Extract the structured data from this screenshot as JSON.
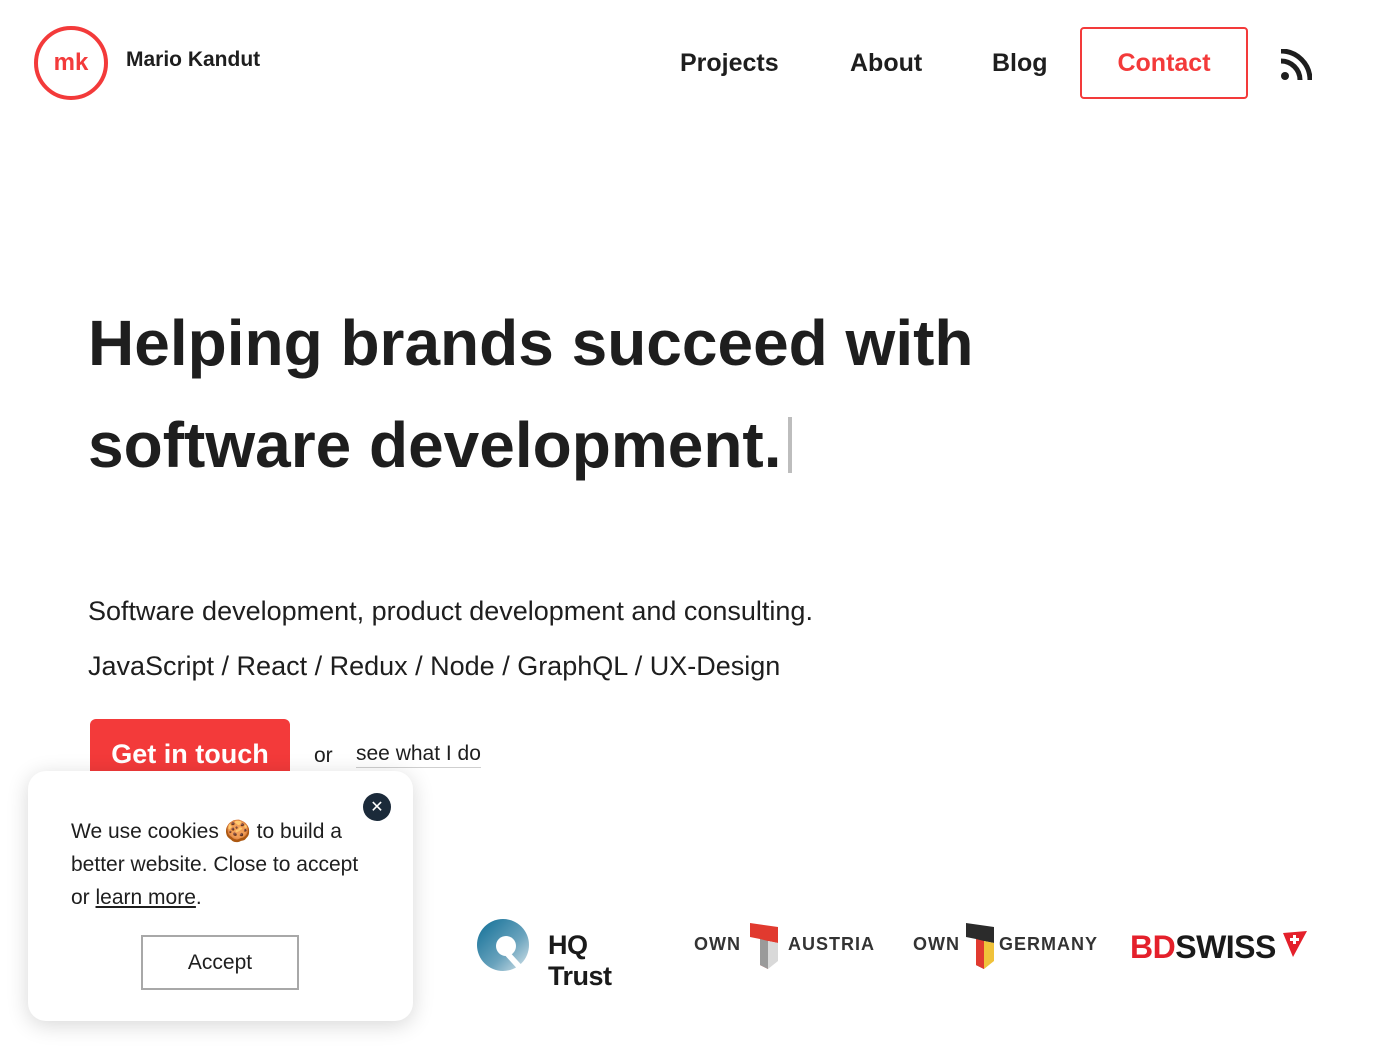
{
  "header": {
    "logo_text": "mk",
    "site_name": "Mario Kandut",
    "nav": {
      "projects": "Projects",
      "about": "About",
      "blog": "Blog",
      "contact": "Contact"
    },
    "rss_icon": "rss-icon"
  },
  "hero": {
    "headline_line1": "Helping brands succeed with",
    "headline_line2": "software development.",
    "subtitle": "Software development, product development and consulting.",
    "tech_stack": "JavaScript / React / Redux / Node / GraphQL / UX-Design",
    "cta_label": "Get in touch",
    "or_text": "or",
    "secondary_link": "see what I do"
  },
  "cookie_banner": {
    "text_before": "We use cookies 🍪 to build a better website. Close to accept or ",
    "link_text": "learn more",
    "text_after": ".",
    "accept_label": "Accept",
    "close_icon": "close-icon"
  },
  "clients": {
    "hq_trust": "HQ Trust",
    "own_austria": {
      "own": "OWN",
      "country": "AUSTRIA"
    },
    "own_germany": {
      "own": "OWN",
      "country": "GERMANY"
    },
    "bdswiss": {
      "part1": "BD",
      "part2": "SWISS"
    }
  },
  "colors": {
    "accent": "#f33a3a",
    "text": "#1e1e1e",
    "close_bg": "#1b2a3a"
  }
}
